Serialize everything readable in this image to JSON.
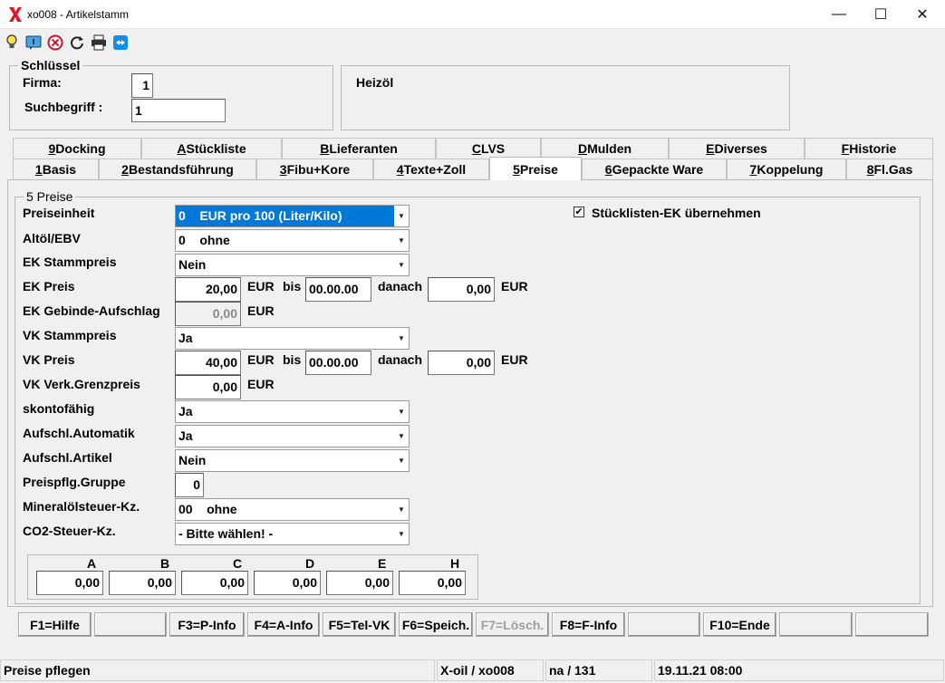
{
  "window": {
    "title": "xo008 - Artikelstamm",
    "minimize_glyph": "—",
    "maximize_glyph": "☐",
    "close_glyph": "✕"
  },
  "toolbar": {
    "icons": [
      "lightbulb-icon",
      "info-icon",
      "cancel-icon",
      "refresh-icon",
      "print-icon",
      "teamviewer-icon"
    ]
  },
  "key_group": {
    "title": "Schlüssel",
    "firma_label": "Firma:",
    "firma_value": "1",
    "suchbegriff_label": "Suchbegriff :",
    "suchbegriff_value": "1",
    "description": "Heizöl"
  },
  "tabs_row1": [
    {
      "key": "9",
      "rest": " Docking"
    },
    {
      "key": "A",
      "rest": " Stückliste"
    },
    {
      "key": "B",
      "rest": " Lieferanten"
    },
    {
      "key": "C",
      "rest": " LVS"
    },
    {
      "key": "D",
      "rest": " Mulden"
    },
    {
      "key": "E",
      "rest": " Diverses"
    },
    {
      "key": "F",
      "rest": " Historie"
    }
  ],
  "tabs_row2": [
    {
      "key": "1",
      "rest": " Basis"
    },
    {
      "key": "2",
      "rest": " Bestandsführung"
    },
    {
      "key": "3",
      "rest": " Fibu+Kore"
    },
    {
      "key": "4",
      "rest": " Texte+Zoll"
    },
    {
      "key": "5",
      "rest": " Preise"
    },
    {
      "key": "6",
      "rest": " Gepackte Ware"
    },
    {
      "key": "7",
      "rest": " Koppelung"
    },
    {
      "key": "8",
      "rest": " Fl.Gas"
    }
  ],
  "prices": {
    "group_title": "5 Preise",
    "preiseinheit_label": "Preiseinheit",
    "preiseinheit_value": "0    EUR pro 100 (Liter/Kilo)",
    "altoel_label": "Altöl/EBV",
    "altoel_value": "0    ohne",
    "ek_stammpreis_label": "EK Stammpreis",
    "ek_stammpreis_value": "Nein",
    "ek_preis_label": "EK Preis",
    "ek_preis_value": "20,00",
    "ek_currency": "EUR",
    "ek_bis_label": "bis",
    "ek_bis_date": "00.00.00",
    "ek_danach_label": "danach",
    "ek_danach_value": "0,00",
    "ek_danach_currency": "EUR",
    "ek_gebinde_label": "EK Gebinde-Aufschlag",
    "ek_gebinde_value": "0,00",
    "ek_gebinde_currency": "EUR",
    "vk_stammpreis_label": "VK Stammpreis",
    "vk_stammpreis_value": "Ja",
    "vk_preis_label": "VK Preis",
    "vk_preis_value": "40,00",
    "vk_currency": "EUR",
    "vk_bis_label": "bis",
    "vk_bis_date": "00.00.00",
    "vk_danach_label": "danach",
    "vk_danach_value": "0,00",
    "vk_danach_currency": "EUR",
    "vk_grenz_label": "VK Verk.Grenzpreis",
    "vk_grenz_value": "0,00",
    "vk_grenz_currency": "EUR",
    "skonto_label": "skontofähig",
    "skonto_value": "Ja",
    "aufschl_auto_label": "Aufschl.Automatik",
    "aufschl_auto_value": "Ja",
    "aufschl_artikel_label": "Aufschl.Artikel",
    "aufschl_artikel_value": "Nein",
    "preispflg_label": "Preispflg.Gruppe",
    "preispflg_value": "0",
    "mineral_label": "Mineralölsteuer-Kz.",
    "mineral_value": "00    ohne",
    "co2_label": "CO2-Steuer-Kz.",
    "co2_value": "- Bitte wählen! -",
    "stueckliste_checkbox_label": "Stücklisten-EK übernehmen",
    "stueckliste_checked": true
  },
  "price_grid": [
    {
      "label": "A",
      "value": "0,00"
    },
    {
      "label": "B",
      "value": "0,00"
    },
    {
      "label": "C",
      "value": "0,00"
    },
    {
      "label": "D",
      "value": "0,00"
    },
    {
      "label": "E",
      "value": "0,00"
    },
    {
      "label": "H",
      "value": "0,00"
    }
  ],
  "fkeys": [
    {
      "label": "F1=Hilfe",
      "enabled": true
    },
    {
      "label": "",
      "enabled": true
    },
    {
      "label": "F3=P-Info",
      "enabled": true
    },
    {
      "label": "F4=A-Info",
      "enabled": true
    },
    {
      "label": "F5=Tel-VK",
      "enabled": true
    },
    {
      "label": "F6=Speich.",
      "enabled": true
    },
    {
      "label": "F7=Lösch.",
      "enabled": false
    },
    {
      "label": "F8=F-Info",
      "enabled": true
    },
    {
      "label": "",
      "enabled": true
    },
    {
      "label": "F10=Ende",
      "enabled": true
    },
    {
      "label": "",
      "enabled": true
    },
    {
      "label": "",
      "enabled": true
    }
  ],
  "statusbar": {
    "message": "Preise pflegen",
    "system": "X-oil / xo008",
    "user": "na / 131",
    "datetime": "19.11.21 08:00"
  },
  "colors": {
    "selection": "#0078d7",
    "logo_red": "#e81123"
  }
}
